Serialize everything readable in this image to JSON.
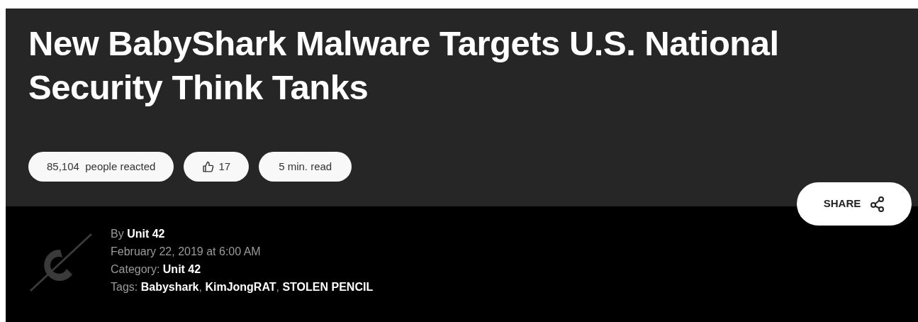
{
  "title": "New BabyShark Malware Targets U.S. National Security Think Tanks",
  "pills": [
    {
      "kind": "reactions",
      "count": "85,104",
      "label": "people reacted"
    },
    {
      "kind": "likes",
      "count": "17"
    },
    {
      "kind": "read",
      "label": "5 min. read"
    }
  ],
  "share_button": {
    "label": "SHARE"
  },
  "author": {
    "label": "By",
    "name": "Unit 42"
  },
  "date": "February 22, 2019 at 6:00 AM",
  "category": {
    "label": "Category:",
    "value": "Unit 42"
  },
  "tags": {
    "label": "Tags:",
    "separator": ",",
    "items": [
      "Babyshark",
      "KimJongRAT",
      "STOLEN PENCIL"
    ]
  }
}
